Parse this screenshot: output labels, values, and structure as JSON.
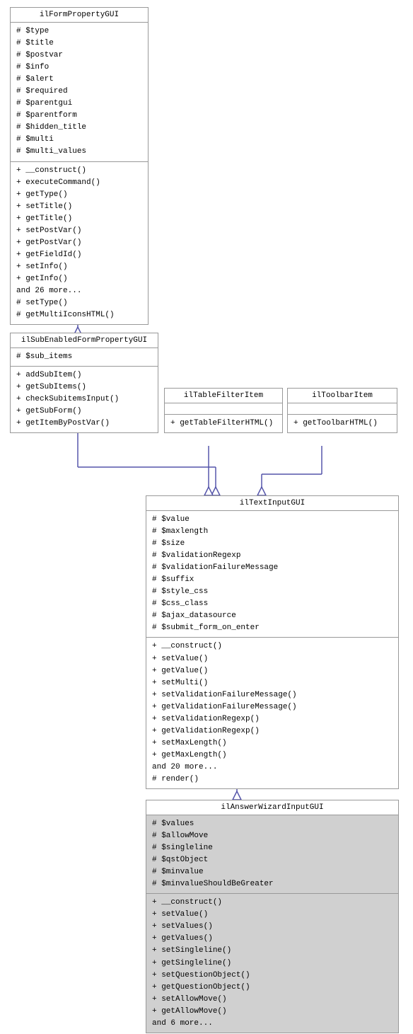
{
  "boxes": {
    "ilFormPropertyGUI": {
      "title": "ilFormPropertyGUI",
      "fields": [
        "# $type",
        "# $title",
        "# $postvar",
        "# $info",
        "# $alert",
        "# $required",
        "# $parentgui",
        "# $parentform",
        "# $hidden_title",
        "# $multi",
        "# $multi_values"
      ],
      "methods": [
        "+ __construct()",
        "+ executeCommand()",
        "+ getType()",
        "+ setTitle()",
        "+ getTitle()",
        "+ setPostVar()",
        "+ getPostVar()",
        "+ getFieldId()",
        "+ setInfo()",
        "+ getInfo()",
        "and 26 more...",
        "# setType()",
        "# getMultiIconsHTML()"
      ]
    },
    "ilSubEnabledFormPropertyGUI": {
      "title": "ilSubEnabledFormPropertyGUI",
      "fields": [
        "# $sub_items"
      ],
      "methods": [
        "+ addSubItem()",
        "+ getSubItems()",
        "+ checkSubitemsInput()",
        "+ getSubForm()",
        "+ getItemByPostVar()"
      ]
    },
    "ilTableFilterItem": {
      "title": "ilTableFilterItem",
      "fields": [],
      "methods": [
        "+ getTableFilterHTML()"
      ]
    },
    "ilToolbarItem": {
      "title": "ilToolbarItem",
      "fields": [],
      "methods": [
        "+ getToolbarHTML()"
      ]
    },
    "ilTextInputGUI": {
      "title": "ilTextInputGUI",
      "fields": [
        "# $value",
        "# $maxlength",
        "# $size",
        "# $validationRegexp",
        "# $validationFailureMessage",
        "# $suffix",
        "# $style_css",
        "# $css_class",
        "# $ajax_datasource",
        "# $submit_form_on_enter"
      ],
      "methods": [
        "+ __construct()",
        "+ setValue()",
        "+ getValue()",
        "+ setMulti()",
        "+ setValidationFailureMessage()",
        "+ getValidationFailureMessage()",
        "+ setValidationRegexp()",
        "+ getValidationRegexp()",
        "+ setMaxLength()",
        "+ getMaxLength()",
        "and 20 more...",
        "# render()"
      ]
    },
    "ilAnswerWizardInputGUI": {
      "title": "ilAnswerWizardInputGUI",
      "fields": [
        "# $values",
        "# $allowMove",
        "# $singleline",
        "# $qstObject",
        "# $minvalue",
        "# $minvalueShouldBeGreater"
      ],
      "methods": [
        "+ __construct()",
        "+ setValue()",
        "+ setValues()",
        "+ getValues()",
        "+ setSingleline()",
        "+ getSingleline()",
        "+ setQuestionObject()",
        "+ getQuestionObject()",
        "+ setAllowMove()",
        "+ getAllowMove()",
        "and 6 more..."
      ]
    }
  }
}
